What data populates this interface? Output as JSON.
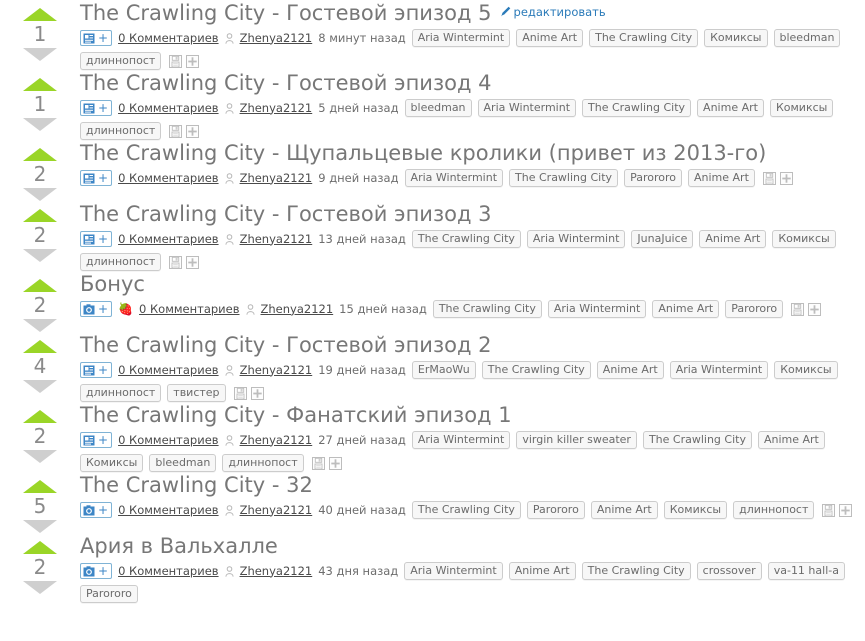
{
  "colors": {
    "upvote": "#9ad527",
    "downvote": "#cfcfcf",
    "title": "#777777",
    "link": "#2b7bb9",
    "tag_bg": "#f7f7f7",
    "tag_border": "#cccccc",
    "badge_border": "#7fb3d5",
    "badge_icon": "#3d86c6"
  },
  "labels": {
    "edit": "редактировать",
    "comments": "0 Комментариев",
    "author": "Zhenya2121",
    "plus": "+",
    "save_icon": "save-icon",
    "add_icon": "add-to-collection-icon",
    "pencil_icon": "pencil-icon",
    "user_icon": "user-icon",
    "article_icon": "article-icon",
    "camera_icon": "camera-icon",
    "strawberry_icon": "🍓"
  },
  "stories": [
    {
      "title": "The Crawling City - Гостевой эпизод 5",
      "votes": "1",
      "type": "article",
      "strawberry": false,
      "edit": true,
      "comments": "0 Комментариев",
      "author": "Zhenya2121",
      "time": "8 минут назад",
      "tags": [
        "Aria Wintermint",
        "Anime Art",
        "The Crawling City",
        "Комиксы",
        "bleedman",
        "длиннопост"
      ],
      "actions": [
        "save-icon",
        "add-to-collection-icon"
      ]
    },
    {
      "title": "The Crawling City - Гостевой эпизод 4",
      "votes": "1",
      "type": "article",
      "strawberry": false,
      "edit": false,
      "comments": "0 Комментариев",
      "author": "Zhenya2121",
      "time": "5 дней назад",
      "tags": [
        "bleedman",
        "Aria Wintermint",
        "The Crawling City",
        "Anime Art",
        "Комиксы",
        "длиннопост"
      ],
      "actions": [
        "save-icon",
        "add-to-collection-icon"
      ]
    },
    {
      "title": "The Crawling City - Щупальцевые кролики (привет из 2013-го)",
      "votes": "2",
      "type": "article",
      "strawberry": false,
      "edit": false,
      "comments": "0 Комментариев",
      "author": "Zhenya2121",
      "time": "9 дней назад",
      "tags": [
        "Aria Wintermint",
        "The Crawling City",
        "Parororo",
        "Anime Art"
      ],
      "actions": [
        "save-icon",
        "add-to-collection-icon"
      ]
    },
    {
      "title": "The Crawling City - Гостевой эпизод 3",
      "votes": "2",
      "type": "article",
      "strawberry": false,
      "edit": false,
      "comments": "0 Комментариев",
      "author": "Zhenya2121",
      "time": "13 дней назад",
      "tags": [
        "The Crawling City",
        "Aria Wintermint",
        "JunaJuice",
        "Anime Art",
        "Комиксы",
        "длиннопост"
      ],
      "actions": [
        "save-icon",
        "add-to-collection-icon"
      ]
    },
    {
      "title": "Бонус",
      "votes": "2",
      "type": "camera",
      "strawberry": true,
      "edit": false,
      "comments": "0 Комментариев",
      "author": "Zhenya2121",
      "time": "15 дней назад",
      "tags": [
        "The Crawling City",
        "Aria Wintermint",
        "Anime Art",
        "Parororo"
      ],
      "actions": [
        "save-icon",
        "add-to-collection-icon"
      ]
    },
    {
      "title": "The Crawling City - Гостевой эпизод 2",
      "votes": "4",
      "type": "article",
      "strawberry": false,
      "edit": false,
      "comments": "0 Комментариев",
      "author": "Zhenya2121",
      "time": "19 дней назад",
      "tags": [
        "ErMaoWu",
        "The Crawling City",
        "Anime Art",
        "Aria Wintermint",
        "Комиксы",
        "длиннопост",
        "твистер"
      ],
      "actions": [
        "save-icon",
        "add-to-collection-icon"
      ]
    },
    {
      "title": "The Crawling City - Фанатский эпизод 1",
      "votes": "2",
      "type": "article",
      "strawberry": false,
      "edit": false,
      "comments": "0 Комментариев",
      "author": "Zhenya2121",
      "time": "27 дней назад",
      "tags": [
        "Aria Wintermint",
        "virgin killer sweater",
        "The Crawling City",
        "Anime Art",
        "Комиксы",
        "bleedman",
        "длиннопост"
      ],
      "actions": [
        "save-icon",
        "add-to-collection-icon"
      ]
    },
    {
      "title": "The Crawling City - 32",
      "votes": "5",
      "type": "camera",
      "strawberry": false,
      "edit": false,
      "comments": "0 Комментариев",
      "author": "Zhenya2121",
      "time": "40 дней назад",
      "tags": [
        "The Crawling City",
        "Parororo",
        "Anime Art",
        "Комиксы",
        "длиннопост"
      ],
      "actions": [
        "save-icon",
        "add-to-collection-icon"
      ]
    },
    {
      "title": "Ария в Вальхалле",
      "votes": "2",
      "type": "camera",
      "strawberry": false,
      "edit": false,
      "comments": "0 Комментариев",
      "author": "Zhenya2121",
      "time": "43 дня назад",
      "tags": [
        "Aria Wintermint",
        "Anime Art",
        "The Crawling City",
        "crossover",
        "va-11 hall-a",
        "Parororo"
      ],
      "actions": []
    }
  ]
}
